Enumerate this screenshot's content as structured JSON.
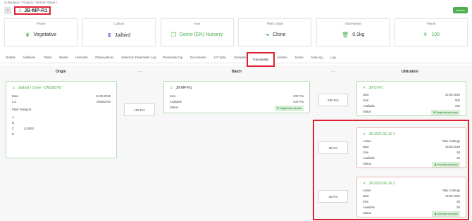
{
  "breadcrumb": "Cultivation / Projects / Mother Plants /",
  "title": "JB-MP-R1",
  "actions_label": "Actions",
  "stats": [
    {
      "label": "Phase",
      "value": "Vegetative",
      "icon": "seedling-icon"
    },
    {
      "label": "Cultivar",
      "value": "Jailbird",
      "icon": "hourglass-icon"
    },
    {
      "label": "Area",
      "value": "Demo (EN) Nursery",
      "icon": "copy-icon"
    },
    {
      "label": "Plant Origin",
      "value": "Clone",
      "icon": "enter-icon"
    },
    {
      "label": "Total Waste",
      "value": "0.1kg",
      "icon": "trash-icon"
    },
    {
      "label": "Plants",
      "value": "100",
      "icon": "plant-icon"
    }
  ],
  "tabs": [
    "Details",
    "Additives",
    "Tasks",
    "Waste",
    "Harvests",
    "Observations",
    "Selection Parameter Log",
    "Parameter log",
    "Documents",
    "IoT data",
    "Samples",
    "Traceability",
    "Articles",
    "Notes",
    "Area log",
    "Log"
  ],
  "active_tab": "Traceability",
  "columns": {
    "origin": "Origin",
    "batch": "Batch",
    "utilization": "Utilization"
  },
  "origin_card": {
    "title": "Jailbird | Clone - DMZ8Z7M",
    "date_label": "Date",
    "date": "22.05.2025",
    "lot_label": "Lot",
    "lot": "DMZ8Z7M",
    "passport_label": "Plant Passport",
    "passport": [
      {
        "k": "A",
        "v": ""
      },
      {
        "k": "B",
        "v": ""
      },
      {
        "k": "C",
        "v": "JL8500"
      },
      {
        "k": "D",
        "v": ""
      }
    ]
  },
  "origin_qty": "100 Pcs",
  "batch_card": {
    "title": "JB-MP-R1",
    "size_label": "Size",
    "size": "100 Pcs",
    "available_label": "Available",
    "available": "100 Pcs",
    "status_label": "Status",
    "status": "Vegetative phase"
  },
  "utilization": [
    {
      "qty": "500 Pcs",
      "title": "JB-CI-R1",
      "rows": [
        {
          "k": "Date",
          "v": "22.05.2025"
        },
        {
          "k": "Size",
          "v": "500"
        },
        {
          "k": "Available",
          "v": "240"
        }
      ],
      "status_label": "Status",
      "status": "Vegetative phase"
    },
    {
      "qty": "25 Pcs",
      "title": "JB-2025-06-16-2",
      "rows": [
        {
          "k": "Action",
          "v": "Take Cuttings"
        },
        {
          "k": "Date",
          "v": "16.06.2025"
        },
        {
          "k": "Size",
          "v": "50"
        },
        {
          "k": "Available",
          "v": "50"
        }
      ],
      "status_label": "Status",
      "status": "Immature phase"
    },
    {
      "qty": "25 Pcs",
      "title": "JB-2025-06-16-2",
      "rows": [
        {
          "k": "Action",
          "v": "Take Cuttings"
        },
        {
          "k": "Date",
          "v": "16.06.2025"
        },
        {
          "k": "Size",
          "v": "50"
        },
        {
          "k": "Available",
          "v": "50"
        }
      ],
      "status_label": "Status",
      "status": "Immature phase"
    }
  ]
}
